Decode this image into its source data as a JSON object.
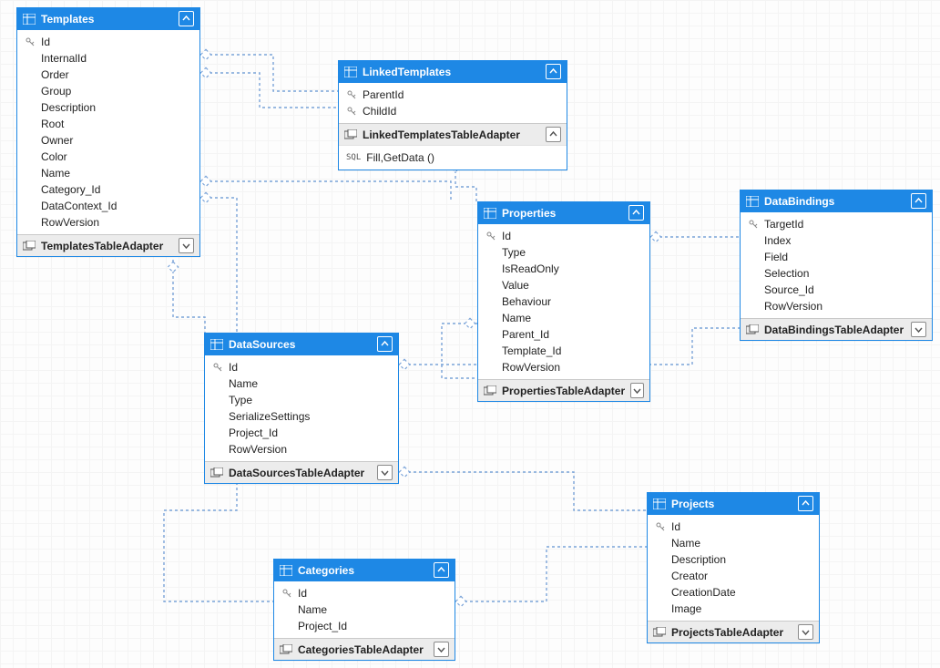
{
  "tables": {
    "templates": {
      "title": "Templates",
      "adapter": "TemplatesTableAdapter",
      "fields": [
        {
          "name": "Id",
          "pk": true
        },
        {
          "name": "InternalId"
        },
        {
          "name": "Order"
        },
        {
          "name": "Group"
        },
        {
          "name": "Description"
        },
        {
          "name": "Root"
        },
        {
          "name": "Owner"
        },
        {
          "name": "Color"
        },
        {
          "name": "Name"
        },
        {
          "name": "Category_Id"
        },
        {
          "name": "DataContext_Id"
        },
        {
          "name": "RowVersion"
        }
      ]
    },
    "linkedTemplates": {
      "title": "LinkedTemplates",
      "adapter": "LinkedTemplatesTableAdapter",
      "fields": [
        {
          "name": "ParentId",
          "pk": true
        },
        {
          "name": "ChildId",
          "pk": true
        }
      ],
      "methods": [
        {
          "label": "Fill,GetData ()"
        }
      ]
    },
    "properties": {
      "title": "Properties",
      "adapter": "PropertiesTableAdapter",
      "fields": [
        {
          "name": "Id",
          "pk": true
        },
        {
          "name": "Type"
        },
        {
          "name": "IsReadOnly"
        },
        {
          "name": "Value"
        },
        {
          "name": "Behaviour"
        },
        {
          "name": "Name"
        },
        {
          "name": "Parent_Id"
        },
        {
          "name": "Template_Id"
        },
        {
          "name": "RowVersion"
        }
      ]
    },
    "dataBindings": {
      "title": "DataBindings",
      "adapter": "DataBindingsTableAdapter",
      "fields": [
        {
          "name": "TargetId",
          "pk": true
        },
        {
          "name": "Index"
        },
        {
          "name": "Field"
        },
        {
          "name": "Selection"
        },
        {
          "name": "Source_Id"
        },
        {
          "name": "RowVersion"
        }
      ]
    },
    "dataSources": {
      "title": "DataSources",
      "adapter": "DataSourcesTableAdapter",
      "fields": [
        {
          "name": "Id",
          "pk": true
        },
        {
          "name": "Name"
        },
        {
          "name": "Type"
        },
        {
          "name": "SerializeSettings"
        },
        {
          "name": "Project_Id"
        },
        {
          "name": "RowVersion"
        }
      ]
    },
    "categories": {
      "title": "Categories",
      "adapter": "CategoriesTableAdapter",
      "fields": [
        {
          "name": "Id",
          "pk": true
        },
        {
          "name": "Name"
        },
        {
          "name": "Project_Id"
        }
      ]
    },
    "projects": {
      "title": "Projects",
      "adapter": "ProjectsTableAdapter",
      "fields": [
        {
          "name": "Id",
          "pk": true
        },
        {
          "name": "Name"
        },
        {
          "name": "Description"
        },
        {
          "name": "Creator"
        },
        {
          "name": "CreationDate"
        },
        {
          "name": "Image"
        }
      ]
    }
  },
  "relations": [
    {
      "from": "templates.Id",
      "to": "linkedTemplates.ParentId"
    },
    {
      "from": "templates.Id",
      "to": "linkedTemplates.ChildId"
    },
    {
      "from": "templates.Category_Id",
      "to": "categories.Id"
    },
    {
      "from": "templates.DataContext_Id",
      "to": "dataSources.Id"
    },
    {
      "from": "templates.Id",
      "to": "properties.Template_Id"
    },
    {
      "from": "linkedTemplates",
      "to": "properties"
    },
    {
      "from": "properties.Id",
      "to": "dataBindings.TargetId"
    },
    {
      "from": "properties.Parent_Id",
      "to": "properties.Id"
    },
    {
      "from": "dataSources.Id",
      "to": "dataBindings.Source_Id"
    },
    {
      "from": "dataSources.Project_Id",
      "to": "projects.Id"
    },
    {
      "from": "categories.Project_Id",
      "to": "projects.Id"
    }
  ]
}
